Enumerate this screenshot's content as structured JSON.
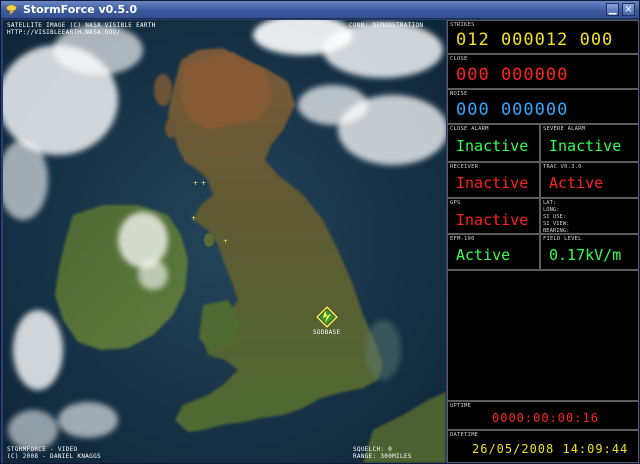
{
  "window": {
    "title": "StormForce v0.5.0",
    "minimize_glyph": "▁",
    "close_glyph": "×"
  },
  "map": {
    "credit_line1": "Satellite image (c) NASA Visible Earth",
    "credit_line2": "http://visibleearth.nasa.gov/",
    "connection": "Conn: Demonstration",
    "marker_label": "Sodbase",
    "footer_line1": "StormForce - Video",
    "footer_line2": "(c) 2008 - Daniel Knaggs",
    "squelch": "Squelch: 0",
    "range": "Range: 300miles"
  },
  "panel": {
    "strikes": {
      "label": "Strikes",
      "value": "012 000012 000",
      "color": "#f0e020"
    },
    "close": {
      "label": "Close",
      "value": "000 000000",
      "color": "#ff2020"
    },
    "noise": {
      "label": "Noise",
      "value": "000 000000",
      "color": "#30a8ff"
    },
    "close_alarm": {
      "label": "Close Alarm",
      "value": "Inactive",
      "color": "#30ff50"
    },
    "severe_alarm": {
      "label": "Severe Alarm",
      "value": "Inactive",
      "color": "#30ff50"
    },
    "receiver": {
      "label": "Receiver",
      "value": "Inactive",
      "color": "#ff2020"
    },
    "trac": {
      "label": "TRAC v0.3.0",
      "value": "Active",
      "color": "#ff2020"
    },
    "gps": {
      "label": "GPS",
      "value": "Inactive",
      "color": "#ff2020",
      "lat": "Lat:",
      "long": "Long:",
      "si_use": "SI Use:",
      "si_view": "SI View:",
      "bearing": "Bearing:"
    },
    "efm": {
      "label": "EFM-100",
      "value": "Active",
      "color": "#30ff50"
    },
    "field_level": {
      "label": "Field Level",
      "value": "0.17kV/m",
      "color": "#30ff50"
    },
    "uptime": {
      "label": "Uptime",
      "value": "0000:00:00:16",
      "color": "#ff2020"
    },
    "datetime": {
      "label": "DateTime",
      "value": "26/05/2008 14:09:44",
      "color": "#f0e020"
    }
  }
}
